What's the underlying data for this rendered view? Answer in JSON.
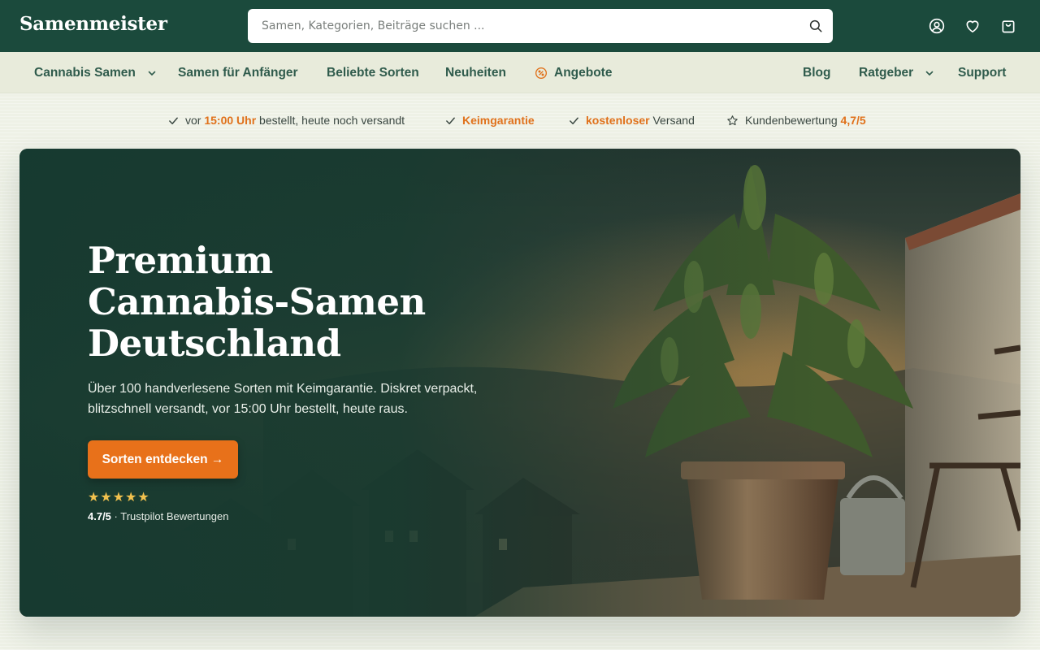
{
  "header": {
    "logo": "Samenmeister",
    "search_placeholder": "Samen, Kategorien, Beiträge suchen ...",
    "icons": [
      "account-icon",
      "heart-icon",
      "shopping-bag-icon"
    ]
  },
  "nav": {
    "left": [
      {
        "label": "Cannabis Samen",
        "dropdown": true
      },
      {
        "label": "Samen für Anfänger",
        "dropdown": false
      },
      {
        "label": "Beliebte Sorten",
        "dropdown": false
      },
      {
        "label": "Neuheiten",
        "dropdown": false
      },
      {
        "label": "Angebote",
        "dropdown": false,
        "icon": "discount-icon"
      }
    ],
    "right": [
      {
        "label": "Blog",
        "dropdown": false
      },
      {
        "label": "Ratgeber",
        "dropdown": true
      },
      {
        "label": "Support",
        "dropdown": false
      }
    ]
  },
  "usps": [
    {
      "icon": "check-icon",
      "pre": "vor ",
      "highlight": "15:00 Uhr",
      "post": " bestellt, heute noch versandt"
    },
    {
      "icon": "check-icon",
      "pre": "",
      "highlight": "Keimgarantie",
      "post": ""
    },
    {
      "icon": "check-icon",
      "pre": "",
      "highlight": "kostenloser",
      "post": " Versand"
    },
    {
      "icon": "star-outline-icon",
      "pre": "Kundenbewertung ",
      "highlight": "4,7/5",
      "post": ""
    }
  ],
  "hero": {
    "title_lines": [
      "Premium",
      "Cannabis-Samen",
      "Deutschland"
    ],
    "subtitle": "Über 100 handverlesene Sorten mit Keimgarantie. Diskret verpackt, blitzschnell versandt, vor 15:00 Uhr bestellt, heute raus.",
    "cta_label": "Sorten entdecken →",
    "stars": "★★★★★",
    "rating_score": "4.7/5",
    "rating_text": " · Trustpilot Bewertungen"
  },
  "colors": {
    "header_bg": "#1b4a3c",
    "nav_bg": "#e8ebdb",
    "nav_text": "#2f5b4c",
    "accent": "#e8711a",
    "highlight_text": "#e0711b"
  }
}
